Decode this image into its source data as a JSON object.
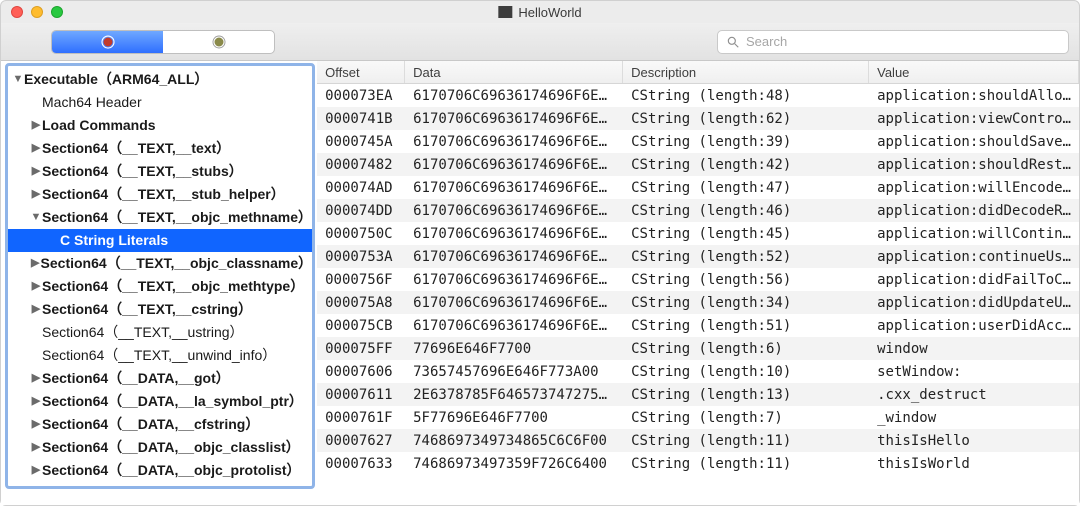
{
  "window": {
    "title": "HelloWorld"
  },
  "toolbar": {
    "seg_left_icon": "inspector-icon",
    "seg_right_icon": "hex-icon",
    "search_placeholder": "Search"
  },
  "sidebar": {
    "root": "Executable（ARM64_ALL）",
    "items": [
      {
        "label": "Mach64 Header",
        "level": 1,
        "arrow": "",
        "bold": false
      },
      {
        "label": "Load Commands",
        "level": 1,
        "arrow": "▶",
        "bold": true
      },
      {
        "label": "Section64（__TEXT,__text）",
        "level": 1,
        "arrow": "▶",
        "bold": true
      },
      {
        "label": "Section64（__TEXT,__stubs）",
        "level": 1,
        "arrow": "▶",
        "bold": true
      },
      {
        "label": "Section64（__TEXT,__stub_helper）",
        "level": 1,
        "arrow": "▶",
        "bold": true
      },
      {
        "label": "Section64（__TEXT,__objc_methname）",
        "level": 1,
        "arrow": "▼",
        "bold": true
      },
      {
        "label": "C String Literals",
        "level": 2,
        "arrow": "",
        "selected": true,
        "bold": true
      },
      {
        "label": "Section64（__TEXT,__objc_classname）",
        "level": 1,
        "arrow": "▶",
        "bold": true
      },
      {
        "label": "Section64（__TEXT,__objc_methtype）",
        "level": 1,
        "arrow": "▶",
        "bold": true
      },
      {
        "label": "Section64（__TEXT,__cstring）",
        "level": 1,
        "arrow": "▶",
        "bold": true
      },
      {
        "label": "Section64（__TEXT,__ustring）",
        "level": 1,
        "arrow": "",
        "bold": false
      },
      {
        "label": "Section64（__TEXT,__unwind_info）",
        "level": 1,
        "arrow": "",
        "bold": false
      },
      {
        "label": "Section64（__DATA,__got）",
        "level": 1,
        "arrow": "▶",
        "bold": true
      },
      {
        "label": "Section64（__DATA,__la_symbol_ptr）",
        "level": 1,
        "arrow": "▶",
        "bold": true
      },
      {
        "label": "Section64（__DATA,__cfstring）",
        "level": 1,
        "arrow": "▶",
        "bold": true
      },
      {
        "label": "Section64（__DATA,__objc_classlist）",
        "level": 1,
        "arrow": "▶",
        "bold": true
      },
      {
        "label": "Section64（__DATA,__objc_protolist）",
        "level": 1,
        "arrow": "▶",
        "bold": true
      }
    ]
  },
  "table": {
    "columns": [
      "Offset",
      "Data",
      "Description",
      "Value"
    ],
    "rows": [
      {
        "offset": "000073EA",
        "data": "6170706C69636174696F6E3…",
        "description": "CString (length:48)",
        "value": "application:shouldAllo…"
      },
      {
        "offset": "0000741B",
        "data": "6170706C69636174696F6E3…",
        "description": "CString (length:62)",
        "value": "application:viewContro…"
      },
      {
        "offset": "0000745A",
        "data": "6170706C69636174696F6E3…",
        "description": "CString (length:39)",
        "value": "application:shouldSave…"
      },
      {
        "offset": "00007482",
        "data": "6170706C69636174696F6E3…",
        "description": "CString (length:42)",
        "value": "application:shouldRest…"
      },
      {
        "offset": "000074AD",
        "data": "6170706C69636174696F6E3…",
        "description": "CString (length:47)",
        "value": "application:willEncode…"
      },
      {
        "offset": "000074DD",
        "data": "6170706C69636174696F6E3…",
        "description": "CString (length:46)",
        "value": "application:didDecodeR…"
      },
      {
        "offset": "0000750C",
        "data": "6170706C69636174696F6E3…",
        "description": "CString (length:45)",
        "value": "application:willContin…"
      },
      {
        "offset": "0000753A",
        "data": "6170706C69636174696F6E3…",
        "description": "CString (length:52)",
        "value": "application:continueUs…"
      },
      {
        "offset": "0000756F",
        "data": "6170706C69636174696F6E3…",
        "description": "CString (length:56)",
        "value": "application:didFailToC…"
      },
      {
        "offset": "000075A8",
        "data": "6170706C69636174696F6E3…",
        "description": "CString (length:34)",
        "value": "application:didUpdateU…"
      },
      {
        "offset": "000075CB",
        "data": "6170706C69636174696F6E3…",
        "description": "CString (length:51)",
        "value": "application:userDidAcc…"
      },
      {
        "offset": "000075FF",
        "data": "77696E646F7700",
        "description": "CString (length:6)",
        "value": "window"
      },
      {
        "offset": "00007606",
        "data": "73657457696E646F773A00",
        "description": "CString (length:10)",
        "value": "setWindow:"
      },
      {
        "offset": "00007611",
        "data": "2E6378785F6465737472756…",
        "description": "CString (length:13)",
        "value": ".cxx_destruct"
      },
      {
        "offset": "0000761F",
        "data": "5F77696E646F7700",
        "description": "CString (length:7)",
        "value": "_window"
      },
      {
        "offset": "00007627",
        "data": "7468697349734865C6C6F00",
        "description": "CString (length:11)",
        "value": "thisIsHello"
      },
      {
        "offset": "00007633",
        "data": "74686973497359F726C6400",
        "description": "CString (length:11)",
        "value": "thisIsWorld"
      }
    ]
  }
}
